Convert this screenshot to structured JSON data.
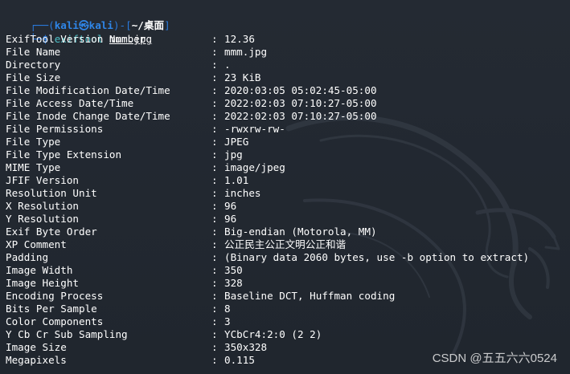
{
  "prompt": {
    "top_left": "┌──(",
    "user": "kali",
    "at": "㉿",
    "host": "kali",
    "mid": ")-[",
    "path": "~/桌面",
    "end": "]",
    "bottom_left": "└─",
    "dollar": "$",
    "command": "exiftool",
    "argument": "mmm.jpg"
  },
  "rows": [
    {
      "key": "ExifTool Version Number",
      "value": "12.36"
    },
    {
      "key": "File Name",
      "value": "mmm.jpg"
    },
    {
      "key": "Directory",
      "value": "."
    },
    {
      "key": "File Size",
      "value": "23 KiB"
    },
    {
      "key": "File Modification Date/Time",
      "value": "2020:03:05 05:02:45-05:00"
    },
    {
      "key": "File Access Date/Time",
      "value": "2022:02:03 07:10:27-05:00"
    },
    {
      "key": "File Inode Change Date/Time",
      "value": "2022:02:03 07:10:27-05:00"
    },
    {
      "key": "File Permissions",
      "value": "-rwxrw-rw-"
    },
    {
      "key": "File Type",
      "value": "JPEG"
    },
    {
      "key": "File Type Extension",
      "value": "jpg"
    },
    {
      "key": "MIME Type",
      "value": "image/jpeg"
    },
    {
      "key": "JFIF Version",
      "value": "1.01"
    },
    {
      "key": "Resolution Unit",
      "value": "inches"
    },
    {
      "key": "X Resolution",
      "value": "96"
    },
    {
      "key": "Y Resolution",
      "value": "96"
    },
    {
      "key": "Exif Byte Order",
      "value": "Big-endian (Motorola, MM)"
    },
    {
      "key": "XP Comment",
      "value": "公正民主公正文明公正和谐"
    },
    {
      "key": "Padding",
      "value": "(Binary data 2060 bytes, use -b option to extract)"
    },
    {
      "key": "Image Width",
      "value": "350"
    },
    {
      "key": "Image Height",
      "value": "328"
    },
    {
      "key": "Encoding Process",
      "value": "Baseline DCT, Huffman coding"
    },
    {
      "key": "Bits Per Sample",
      "value": "8"
    },
    {
      "key": "Color Components",
      "value": "3"
    },
    {
      "key": "Y Cb Cr Sub Sampling",
      "value": "YCbCr4:2:0 (2 2)"
    },
    {
      "key": "Image Size",
      "value": "350x328"
    },
    {
      "key": "Megapixels",
      "value": "0.115"
    }
  ],
  "separator": ":",
  "watermark": "CSDN @五五六六0524",
  "colors": {
    "background": "#222831",
    "prompt_blue": "#2f86e8",
    "command_cyan": "#4ec1c7",
    "text": "#ffffff"
  },
  "icons": {
    "background_logo": "kali-dragon-icon"
  }
}
